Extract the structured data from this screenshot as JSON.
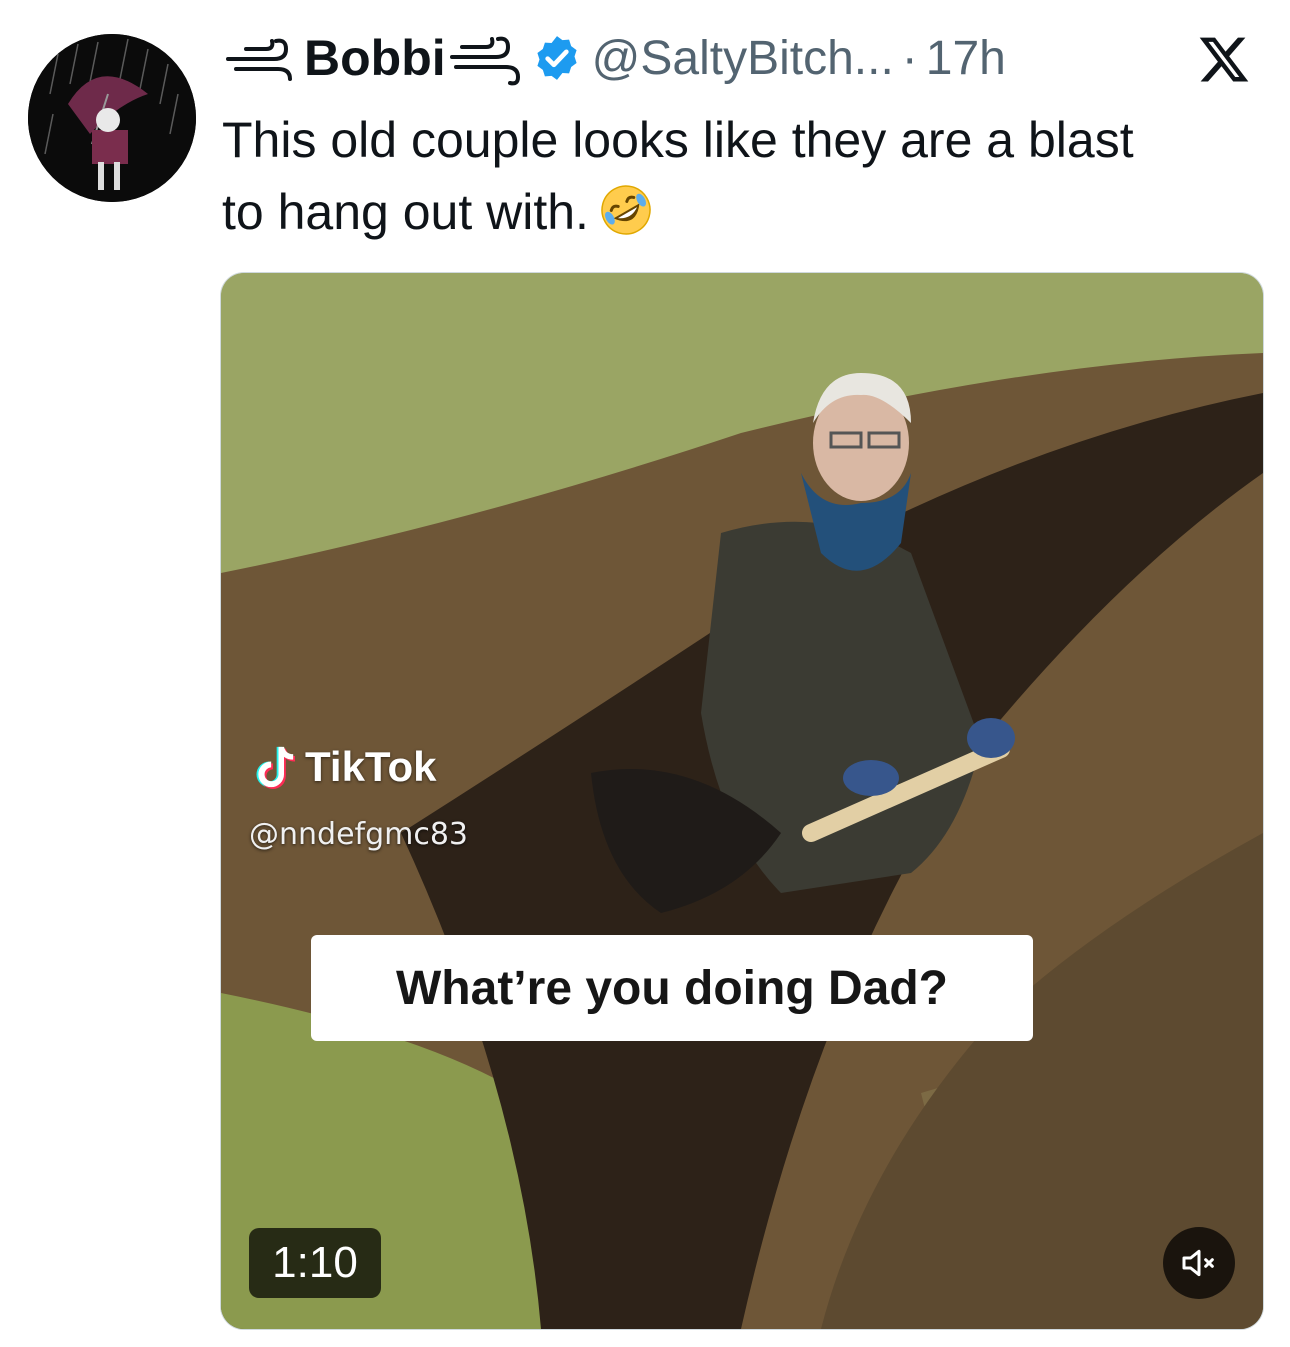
{
  "tweet": {
    "display_name": "Bobbi",
    "handle": "@SaltyBitch...",
    "separator": "·",
    "time": "17h",
    "text_line1": "This old couple looks like they are a blast",
    "text_line2": "to hang out with.",
    "verified_color": "#1d9bf0"
  },
  "video": {
    "watermark_brand": "TikTok",
    "watermark_handle": "@nndefgmc83",
    "caption": "What’re you doing Dad?",
    "duration": "1:10",
    "muted": true
  },
  "icons": {
    "close": "x-logo-icon",
    "sound": "volume-muted-icon",
    "emoji": "rolling-on-floor-laughing-emoji"
  }
}
